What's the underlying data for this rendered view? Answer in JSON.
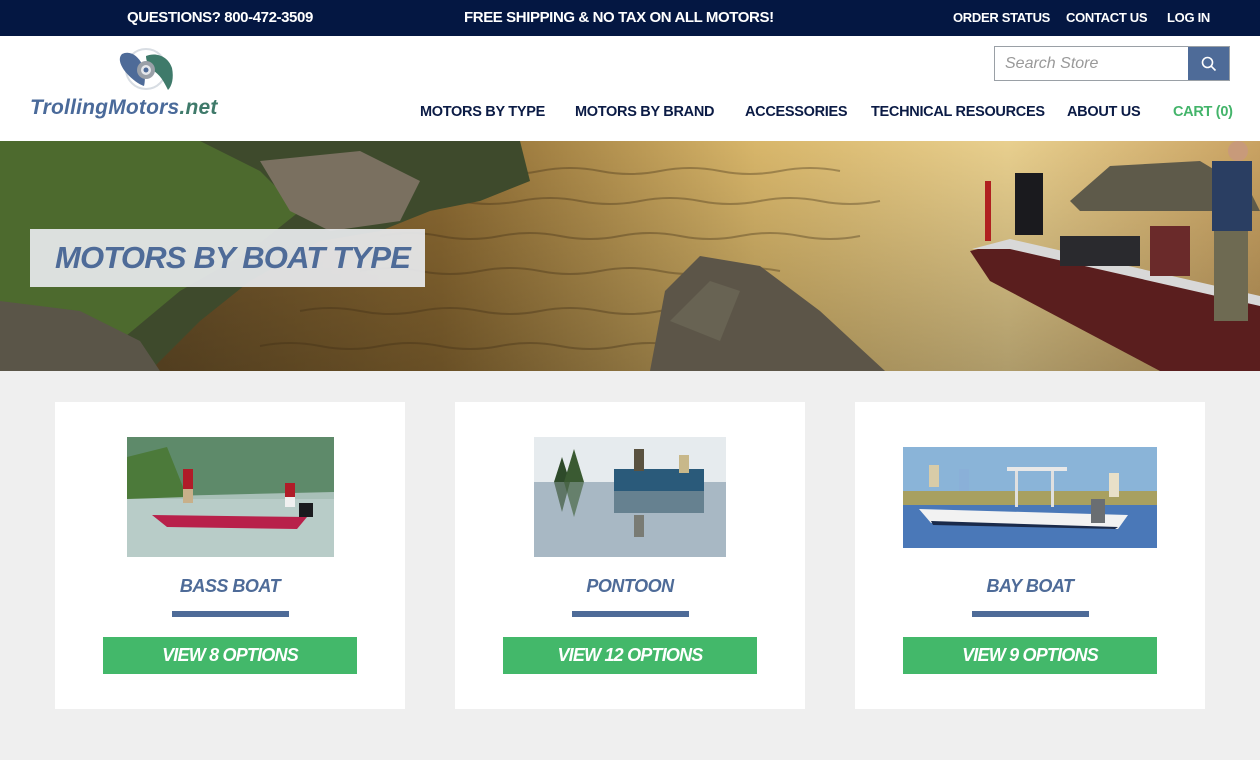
{
  "topbar": {
    "phone": "QUESTIONS? 800-472-3509",
    "promo": "FREE SHIPPING & NO TAX ON ALL MOTORS!",
    "links": [
      "ORDER STATUS",
      "CONTACT US",
      "LOG IN"
    ]
  },
  "header": {
    "logo": {
      "text_main": "TrollingMotors",
      "text_suffix": ".net",
      "icon": "propeller-icon"
    },
    "search": {
      "placeholder": "Search Store",
      "value": "",
      "button_icon": "search-icon"
    },
    "nav": [
      "MOTORS BY TYPE",
      "MOTORS BY BRAND",
      "ACCESSORIES",
      "TECHNICAL RESOURCES",
      "ABOUT US"
    ],
    "cart": "CART (0)"
  },
  "hero": {
    "title": "MOTORS BY BOAT TYPE",
    "image": "lake-with-rocks-and-bass-boat-photo"
  },
  "cards": [
    {
      "title": "BASS BOAT",
      "cta": "VIEW 8 OPTIONS",
      "options": 8,
      "image": "bass-boat-photo"
    },
    {
      "title": "PONTOON",
      "cta": "VIEW 12 OPTIONS",
      "options": 12,
      "image": "pontoon-photo"
    },
    {
      "title": "BAY BOAT",
      "cta": "VIEW 9 OPTIONS",
      "options": 9,
      "image": "bay-boat-photo"
    }
  ],
  "colors": {
    "topbar_bg": "#041742",
    "nav_text": "#0b1b45",
    "brand_blue": "#4e6b98",
    "cta_green": "#43b86a",
    "cart_green": "#43b46a",
    "page_bg": "#efefef"
  }
}
